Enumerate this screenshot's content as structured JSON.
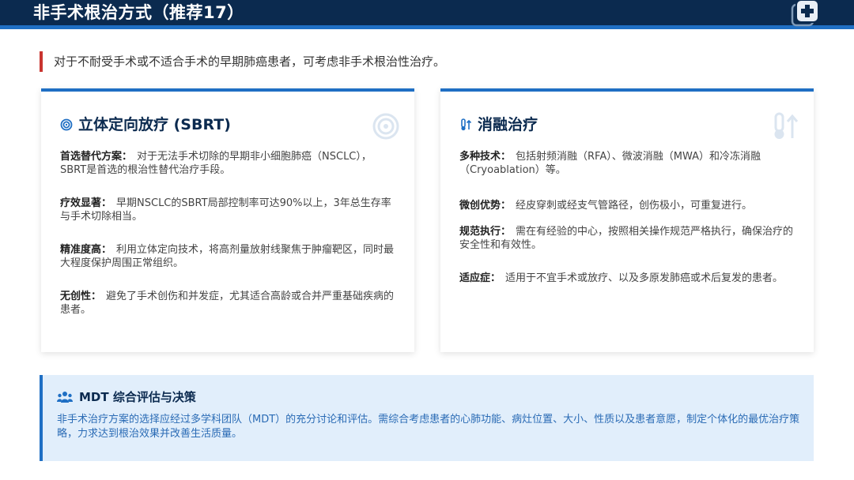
{
  "header": {
    "title": "非手术根治方式（推荐17）",
    "logo_icon": "medical-plus-icon"
  },
  "intro": {
    "text": "对于不耐受手术或不适合手术的早期肺癌患者，可考虑非手术根治性治疗。"
  },
  "sbrt": {
    "icon": "target-icon",
    "title": "立体定向放疗 (SBRT)",
    "items": [
      {
        "label": "首选替代方案：",
        "text": "对于无法手术切除的早期非小细胞肺癌（NSCLC），SBRT是首选的根治性替代治疗手段。"
      },
      {
        "label": "疗效显著：",
        "text": "早期NSCLC的SBRT局部控制率可达90%以上，3年总生存率与手术切除相当。"
      },
      {
        "label": "精准度高：",
        "text": "利用立体定向技术，将高剂量放射线聚焦于肿瘤靶区，同时最大程度保护周围正常组织。"
      },
      {
        "label": "无创性：",
        "text": "避免了手术创伤和并发症，尤其适合高龄或合并严重基础疾病的患者。"
      }
    ]
  },
  "ablation": {
    "icon": "thermometer-icon",
    "title": "消融治疗",
    "items": [
      {
        "label": "多种技术：",
        "text": "包括射频消融（RFA）、微波消融（MWA）和冷冻消融（Cryoablation）等。"
      },
      {
        "label": "微创优势：",
        "text": "经皮穿刺或经支气管路径，创伤极小，可重复进行。"
      },
      {
        "label": "规范执行：",
        "text": "需在有经验的中心，按照相关操作规范严格执行，确保治疗的安全性和有效性。"
      },
      {
        "label": "适应症：",
        "text": "适用于不宜手术或放疗、以及多原发肺癌或术后复发的患者。"
      }
    ]
  },
  "mdt": {
    "icon": "team-icon",
    "title": "MDT 综合评估与决策",
    "text": "非手术治疗方案的选择应经过多学科团队（MDT）的充分讨论和评估。需综合考虑患者的心肺功能、病灶位置、大小、性质以及患者意愿，制定个体化的最优治疗策略，力求达到根治效果并改善生活质量。"
  },
  "colors": {
    "navy": "#0b2a4f",
    "accent_blue": "#1f6fc4",
    "accent_red": "#c9342f",
    "mdt_bg": "#e1eefb"
  }
}
